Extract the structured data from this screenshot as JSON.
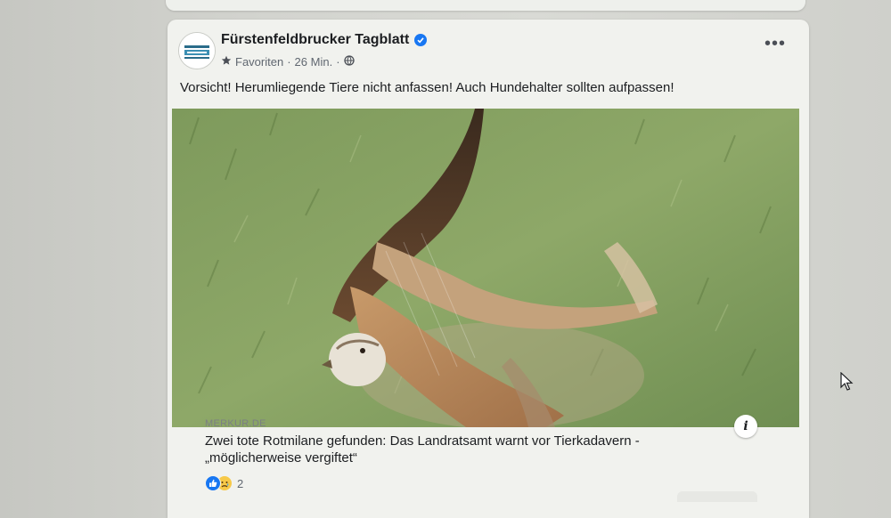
{
  "post": {
    "page_name": "Fürstenfeldbrucker Tagblatt",
    "verified_icon": "verified-badge-icon",
    "audience_label": "Favoriten",
    "separator": "·",
    "timestamp": "26 Min.",
    "privacy_icon": "globe-icon",
    "more_icon": "more-options-icon",
    "more_label": "•••",
    "text": "Vorsicht! Herumliegende Tiere nicht anfassen! Auch Hundehalter sollten aufpassen!",
    "link": {
      "source": "MERKUR.DE",
      "title": "Zwei tote Rotmilane gefunden: Das Landratsamt warnt vor Tierkadavern - „möglicherweise vergiftet“",
      "info_label": "i"
    },
    "reactions": {
      "types": [
        "like",
        "sad"
      ],
      "count": "2"
    }
  },
  "colors": {
    "accent": "#1877f2",
    "card_bg": "#f1f2ee",
    "text": "#1c1e21",
    "secondary_text": "#606770"
  }
}
